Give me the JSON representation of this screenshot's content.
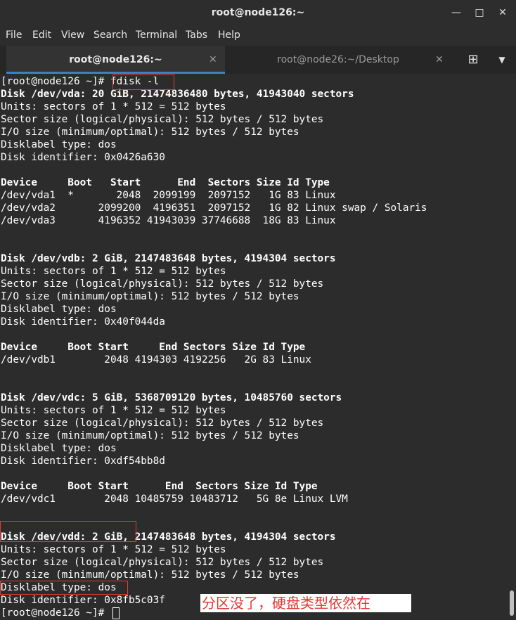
{
  "window": {
    "title": "root@node126:~",
    "minimize_icon": "minimize-icon",
    "maximize_icon": "maximize-icon",
    "close_icon": "close-icon"
  },
  "menu": [
    "File",
    "Edit",
    "View",
    "Search",
    "Terminal",
    "Tabs",
    "Help"
  ],
  "tabs": [
    {
      "label": "root@node126:~",
      "active": true
    },
    {
      "label": "root@node26:~/Desktop",
      "active": false
    }
  ],
  "tab_tools": {
    "new_tab_icon": "new-tab-icon",
    "menu_icon": "chevron-down-icon"
  },
  "terminal": {
    "lines": [
      {
        "text": "[root@node126 ~]# fdisk -l",
        "bold": false
      },
      {
        "text": "Disk /dev/vda: 20 GiB, 21474836480 bytes, 41943040 sectors",
        "bold": true
      },
      {
        "text": "Units: sectors of 1 * 512 = 512 bytes",
        "bold": false
      },
      {
        "text": "Sector size (logical/physical): 512 bytes / 512 bytes",
        "bold": false
      },
      {
        "text": "I/O size (minimum/optimal): 512 bytes / 512 bytes",
        "bold": false
      },
      {
        "text": "Disklabel type: dos",
        "bold": false
      },
      {
        "text": "Disk identifier: 0x0426a630",
        "bold": false
      },
      {
        "text": "",
        "bold": false
      },
      {
        "text": "Device     Boot   Start      End  Sectors Size Id Type",
        "bold": true
      },
      {
        "text": "/dev/vda1  *       2048  2099199  2097152   1G 83 Linux",
        "bold": false
      },
      {
        "text": "/dev/vda2       2099200  4196351  2097152   1G 82 Linux swap / Solaris",
        "bold": false
      },
      {
        "text": "/dev/vda3       4196352 41943039 37746688  18G 83 Linux",
        "bold": false
      },
      {
        "text": "",
        "bold": false
      },
      {
        "text": "",
        "bold": false
      },
      {
        "text": "Disk /dev/vdb: 2 GiB, 2147483648 bytes, 4194304 sectors",
        "bold": true
      },
      {
        "text": "Units: sectors of 1 * 512 = 512 bytes",
        "bold": false
      },
      {
        "text": "Sector size (logical/physical): 512 bytes / 512 bytes",
        "bold": false
      },
      {
        "text": "I/O size (minimum/optimal): 512 bytes / 512 bytes",
        "bold": false
      },
      {
        "text": "Disklabel type: dos",
        "bold": false
      },
      {
        "text": "Disk identifier: 0x40f044da",
        "bold": false
      },
      {
        "text": "",
        "bold": false
      },
      {
        "text": "Device     Boot Start     End Sectors Size Id Type",
        "bold": true
      },
      {
        "text": "/dev/vdb1        2048 4194303 4192256   2G 83 Linux",
        "bold": false
      },
      {
        "text": "",
        "bold": false
      },
      {
        "text": "",
        "bold": false
      },
      {
        "text": "Disk /dev/vdc: 5 GiB, 5368709120 bytes, 10485760 sectors",
        "bold": true
      },
      {
        "text": "Units: sectors of 1 * 512 = 512 bytes",
        "bold": false
      },
      {
        "text": "Sector size (logical/physical): 512 bytes / 512 bytes",
        "bold": false
      },
      {
        "text": "I/O size (minimum/optimal): 512 bytes / 512 bytes",
        "bold": false
      },
      {
        "text": "Disklabel type: dos",
        "bold": false
      },
      {
        "text": "Disk identifier: 0xdf54bb8d",
        "bold": false
      },
      {
        "text": "",
        "bold": false
      },
      {
        "text": "Device     Boot Start      End  Sectors Size Id Type",
        "bold": true
      },
      {
        "text": "/dev/vdc1        2048 10485759 10483712   5G 8e Linux LVM",
        "bold": false
      },
      {
        "text": "",
        "bold": false
      },
      {
        "text": "",
        "bold": false
      },
      {
        "text": "Disk /dev/vdd: 2 GiB, 2147483648 bytes, 4194304 sectors",
        "bold": true
      },
      {
        "text": "Units: sectors of 1 * 512 = 512 bytes",
        "bold": false
      },
      {
        "text": "Sector size (logical/physical): 512 bytes / 512 bytes",
        "bold": false
      },
      {
        "text": "I/O size (minimum/optimal): 512 bytes / 512 bytes",
        "bold": false
      },
      {
        "text": "Disklabel type: dos",
        "bold": false
      },
      {
        "text": "Disk identifier: 0x8fb5c03f",
        "bold": false
      },
      {
        "text": "[root@node126 ~]# ",
        "bold": false
      }
    ]
  },
  "annotation": {
    "text": "分区没了，硬盘类型依然在",
    "color": "#e53935"
  },
  "colors": {
    "accent": "#3f7fc8",
    "highlight": "#e53935",
    "terminal_bg": "#2c2c2c"
  }
}
